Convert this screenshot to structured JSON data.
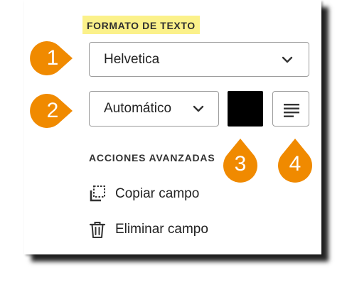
{
  "text_format": {
    "heading": "FORMATO DE TEXTO",
    "font_select": {
      "value": "Helvetica",
      "icon": "chevron-down-icon"
    },
    "size_select": {
      "value": "Automático",
      "icon": "chevron-down-icon"
    },
    "color_swatch": {
      "color": "#000000"
    },
    "align_button": {
      "icon": "align-justify-icon"
    }
  },
  "advanced_actions": {
    "heading": "ACCIONES AVANZADAS",
    "items": [
      {
        "label": "Copiar campo",
        "icon": "copy-field-icon"
      },
      {
        "label": "Eliminar campo",
        "icon": "trash-icon"
      }
    ]
  },
  "callouts": [
    {
      "number": "1",
      "color": "#f08a00"
    },
    {
      "number": "2",
      "color": "#f08a00"
    },
    {
      "number": "3",
      "color": "#f08a00"
    },
    {
      "number": "4",
      "color": "#f08a00"
    }
  ]
}
